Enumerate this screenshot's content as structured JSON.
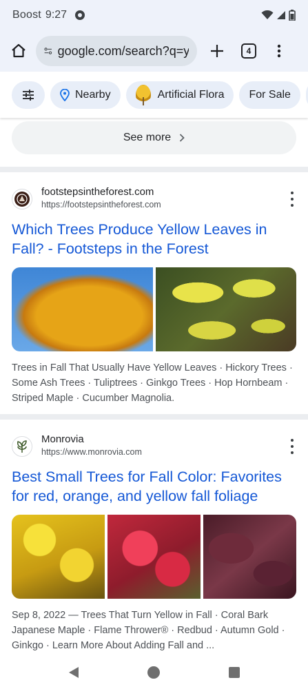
{
  "status_bar": {
    "carrier": "Boost",
    "time": "9:27",
    "icons": [
      "app-notification-icon",
      "wifi-icon",
      "cell-signal-icon",
      "battery-icon"
    ]
  },
  "browser": {
    "url": "google.com/search?q=yellow+leaves",
    "tab_count": "4",
    "icons": [
      "home-icon",
      "site-info-icon",
      "new-tab-icon",
      "tab-switcher-icon",
      "more-vert-icon"
    ]
  },
  "chips": [
    {
      "icon": "tune-icon",
      "label": ""
    },
    {
      "icon": "location-pin-icon",
      "label": "Nearby"
    },
    {
      "icon": "thumbnail",
      "label": "Artificial Flora"
    },
    {
      "icon": "",
      "label": "For Sale"
    }
  ],
  "see_more": {
    "label": "See more"
  },
  "results": [
    {
      "site_name": "footstepsintheforest.com",
      "url": "https://footstepsintheforest.com",
      "title": "Which Trees Produce Yellow Leaves in Fall? - Footsteps in the Forest",
      "snippet": "Trees in Fall That Usually Have Yellow Leaves · Hickory Trees · Some Ash Trees · Tuliptrees · Ginkgo Trees · Hop Hornbeam · Striped Maple · Cucumber Magnolia.",
      "images": [
        "yellow tree against blue sky",
        "yellow leaves close-up"
      ]
    },
    {
      "site_name": "Monrovia",
      "url": "https://www.monrovia.com",
      "title": "Best Small Trees for Fall Color: Favorites for red, orange, and yellow fall foliage",
      "snippet": "Sep 8, 2022 — Trees That Turn Yellow in Fall · Coral Bark Japanese Maple · Flame Thrower® · Redbud · Autumn Gold · Ginkgo · Learn More About Adding Fall and ...",
      "images": [
        "yellow ginkgo leaves",
        "red japanese maple",
        "purple smoke tree leaves"
      ]
    }
  ],
  "colors": {
    "link_blue": "#1558d6",
    "chrome_bg": "#eef2fa",
    "chip_bg": "#e8eef8"
  }
}
